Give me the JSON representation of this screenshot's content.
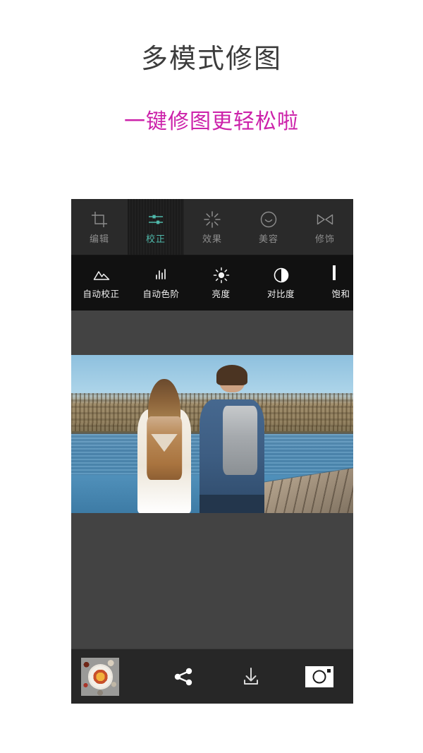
{
  "promo": {
    "title": "多模式修图",
    "subtitle": "一键修图更轻松啦",
    "title_color": "#3c3c3c",
    "subtitle_color": "#cc22aa"
  },
  "app": {
    "accent_color": "#4fb9ab",
    "tab_bar_bg": "#2a2a2a",
    "tool_strip_bg": "#111111",
    "canvas_bg": "#434343",
    "action_bar_bg": "#272727",
    "mode_tabs": [
      {
        "label": "编辑",
        "icon": "crop-icon",
        "active": false
      },
      {
        "label": "校正",
        "icon": "sliders-icon",
        "active": true
      },
      {
        "label": "效果",
        "icon": "sparkle-icon",
        "active": false
      },
      {
        "label": "美容",
        "icon": "smiley-face-icon",
        "active": false
      },
      {
        "label": "修饰",
        "icon": "bowtie-retouch-icon",
        "active": false
      }
    ],
    "tools": [
      {
        "label": "自动校正",
        "icon": "mountain-auto-correct-icon"
      },
      {
        "label": "自动色阶",
        "icon": "histogram-levels-icon"
      },
      {
        "label": "亮度",
        "icon": "sun-brightness-icon"
      },
      {
        "label": "对比度",
        "icon": "contrast-half-circle-icon"
      },
      {
        "label": "饱和",
        "icon": "saturation-gradient-icon"
      }
    ],
    "actions": [
      {
        "label": "",
        "icon": "photo-thumbnail"
      },
      {
        "label": "",
        "icon": "share-icon"
      },
      {
        "label": "",
        "icon": "download-icon"
      },
      {
        "label": "",
        "icon": "camera-icon"
      }
    ]
  }
}
